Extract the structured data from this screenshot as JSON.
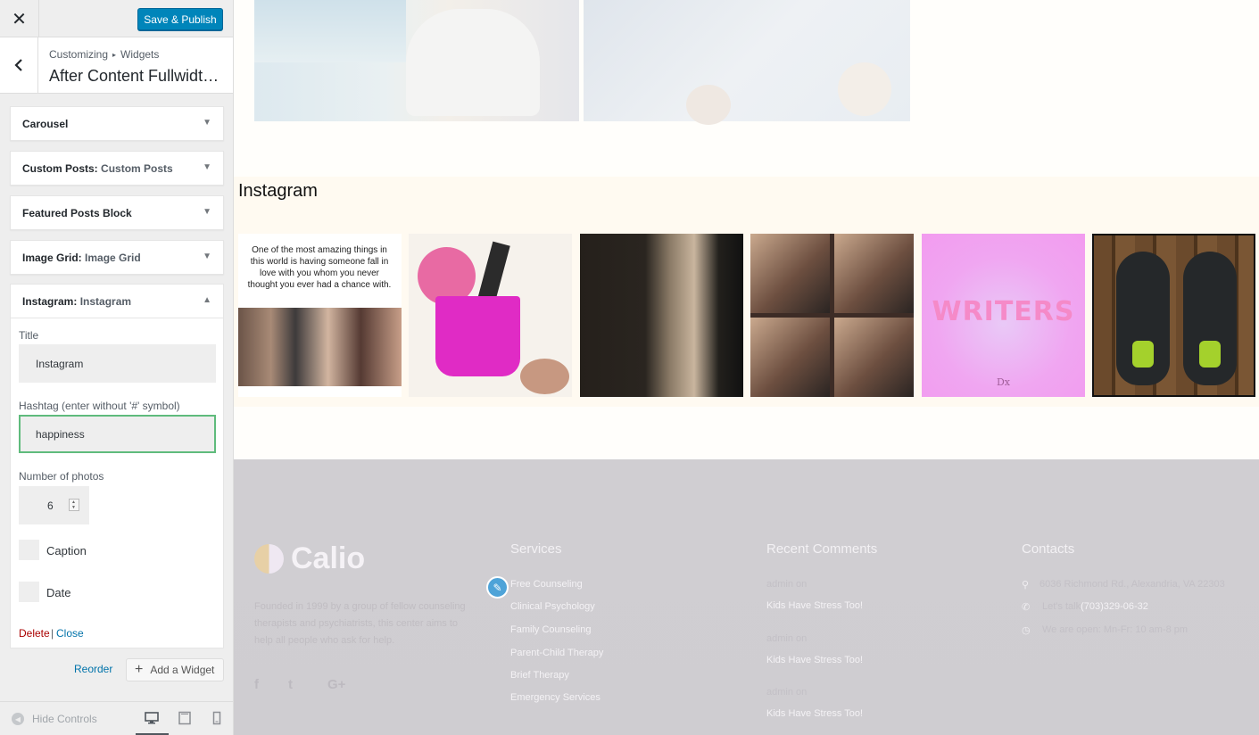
{
  "header": {
    "publish_label": "Save & Publish"
  },
  "info": {
    "crumb_root": "Customizing",
    "crumb_sep": "▸",
    "crumb_section": "Widgets",
    "title": "After Content Fullwidth ..."
  },
  "widgets": [
    {
      "title": "Carousel",
      "subtitle": ""
    },
    {
      "title": "Custom Posts:",
      "subtitle": "Custom Posts"
    },
    {
      "title": "Featured Posts Block",
      "subtitle": ""
    },
    {
      "title": "Image Grid:",
      "subtitle": "Image Grid"
    }
  ],
  "instagram_widget": {
    "title": "Instagram:",
    "subtitle": "Instagram",
    "title_label": "Title",
    "title_value": "Instagram",
    "hashtag_label": "Hashtag (enter without '#' symbol)",
    "hashtag_value": "happiness",
    "photos_label": "Number of photos",
    "photos_value": "6",
    "caption_label": "Caption",
    "date_label": "Date",
    "delete_label": "Delete",
    "link_sep": "|",
    "close_label": "Close"
  },
  "actions": {
    "reorder_label": "Reorder",
    "add_widget_label": "Add a Widget"
  },
  "sidebar_footer": {
    "hide_controls_label": "Hide Controls"
  },
  "preview": {
    "instagram_heading": "Instagram",
    "photo1_quote": "One of the most amazing things in this world is having someone fall in love with you whom you never thought you ever had a chance with.",
    "photo5_word": "WRITERS",
    "photo5_sig": "Dx"
  },
  "footer": {
    "brand": "Calio",
    "about": "Founded in 1999 by a group of fellow counseling therapists and psychiatrists, this center aims to help all people who ask for help.",
    "services_heading": "Services",
    "services": [
      "Free Counseling",
      "Clinical Psychology",
      "Family Counseling",
      "Parent-Child Therapy",
      "Brief Therapy",
      "Emergency Services"
    ],
    "comments_heading": "Recent Comments",
    "comments": [
      {
        "author": "admin",
        "on": "on",
        "post": "Kids Have Stress Too!"
      },
      {
        "author": "admin",
        "on": "on",
        "post": "Kids Have Stress Too!"
      },
      {
        "author": "admin",
        "on": "on",
        "post": "Kids Have Stress Too!"
      }
    ],
    "contacts_heading": "Contacts",
    "address": "6036 Richmond Rd., Alexandria, VA 22303",
    "phone_prefix": "Let's talk",
    "phone": "(703)329-06-32",
    "hours": "We are open: Mn-Fr: 10 am-8 pm",
    "social": [
      "f",
      "t",
      "G+"
    ]
  },
  "colors": {
    "primary_button": "#0085ba",
    "focus_border": "#5fbb7c",
    "delete": "#aa0000",
    "link": "#0073aa"
  }
}
